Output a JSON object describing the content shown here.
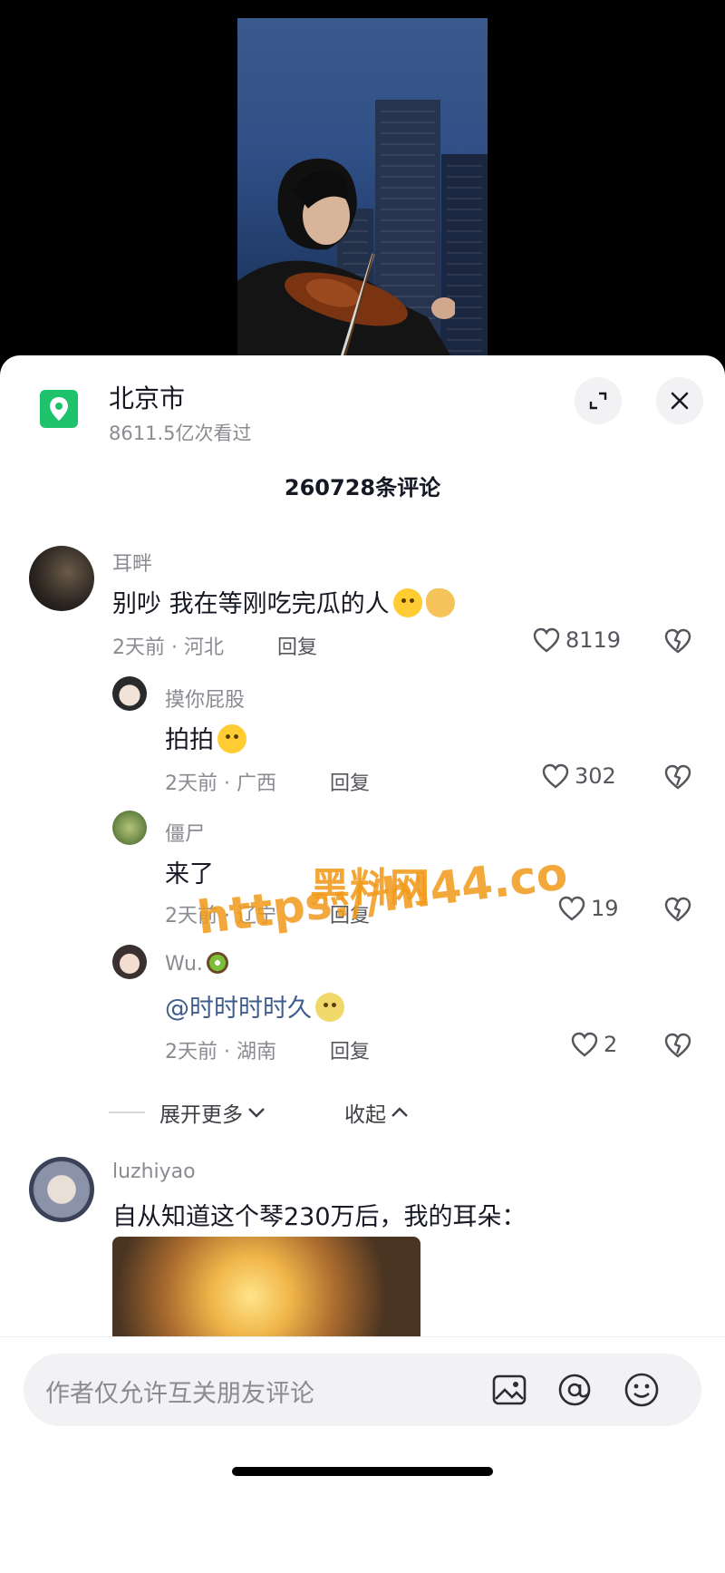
{
  "location": {
    "title": "北京市",
    "subtitle": "8611.5亿次看过"
  },
  "comments_count": "260728条评论",
  "comments": [
    {
      "user": "耳畔",
      "text": "别吵 我在等刚吃完瓜的人",
      "time_place": "2天前 · 河北",
      "reply": "回复",
      "likes": "8119",
      "replies": [
        {
          "user": "摸你屁股",
          "text": "拍拍",
          "time_place": "2天前 · 广西",
          "reply": "回复",
          "likes": "302"
        },
        {
          "user": "僵尸",
          "text": "来了",
          "time_place": "2天前 · 辽宁",
          "reply": "回复",
          "likes": "19"
        },
        {
          "user": "Wu.",
          "mention": "@时时时时久",
          "time_place": "2天前 · 湖南",
          "reply": "回复",
          "likes": "2"
        }
      ],
      "expand_more": "展开更多",
      "collapse": "收起"
    },
    {
      "user": "luzhiyao",
      "text": "自从知道这个琴230万后，我的耳朵："
    }
  ],
  "input": {
    "placeholder": "作者仅允许互关朋友评论"
  },
  "watermark": {
    "line1": "黑料网",
    "line2": "https://hl44.co"
  },
  "colors": {
    "location_badge": "#1ec26b",
    "watermark": "#f29a1a",
    "mention": "#3f5d8c"
  },
  "icons": [
    "location-pin-icon",
    "expand-icon",
    "close-icon",
    "heart-icon",
    "broken-heart-icon",
    "chevron-down-icon",
    "chevron-up-icon",
    "image-icon",
    "at-icon",
    "emoji-icon"
  ]
}
